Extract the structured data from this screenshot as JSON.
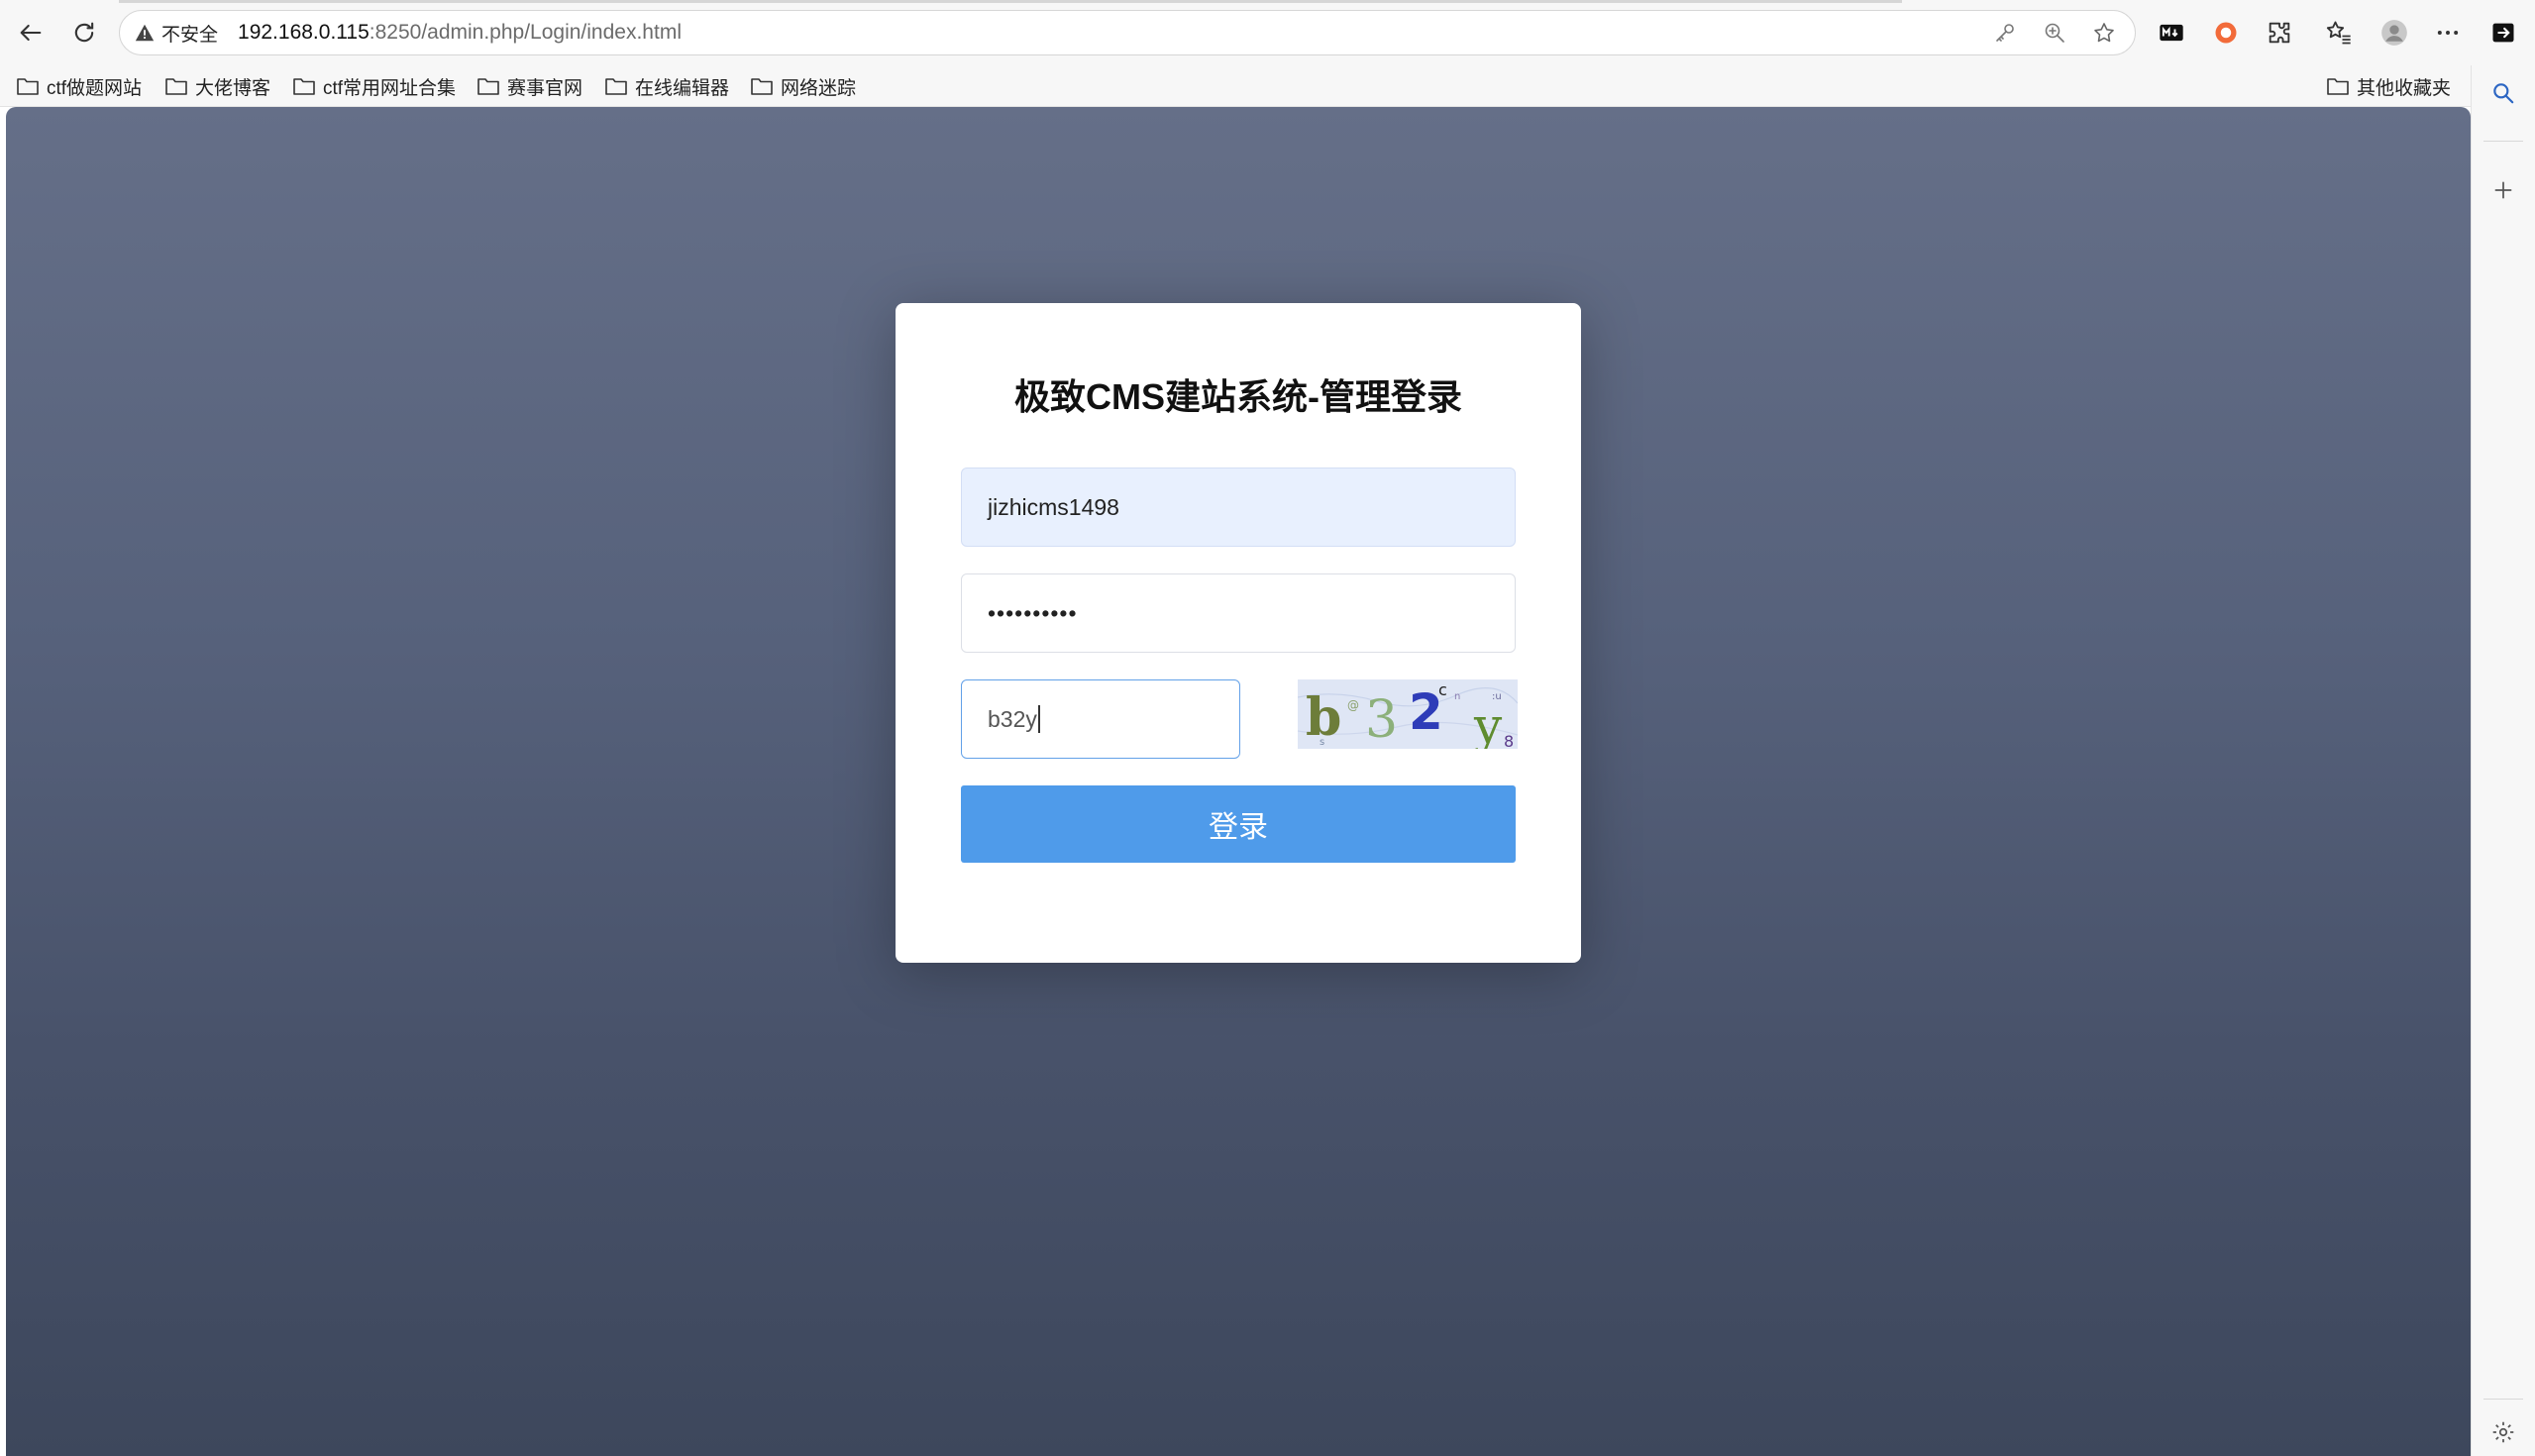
{
  "toolbar": {
    "security_label": "不安全",
    "url_host": "192.168.0.115",
    "url_path": ":8250/admin.php/Login/index.html",
    "extension_md_label": "M↓"
  },
  "bookmarks": {
    "items": [
      {
        "label": "ctf做题网站"
      },
      {
        "label": "大佬博客"
      },
      {
        "label": "ctf常用网址合集"
      },
      {
        "label": "赛事官网"
      },
      {
        "label": "在线编辑器"
      },
      {
        "label": "网络迷踪"
      }
    ],
    "other_label": "其他收藏夹"
  },
  "login": {
    "title": "极致CMS建站系统-管理登录",
    "username": "jizhicms1498",
    "password_masked": "••••••••••",
    "captcha_input": "b32y",
    "captcha_chars": [
      "b",
      "3",
      "2",
      "c",
      "y",
      "8"
    ],
    "login_button": "登录"
  },
  "colors": {
    "button": "#4f9bea",
    "background_top": "#656f88",
    "background_bottom": "#3d475c",
    "autofill": "#e8f0fe"
  }
}
